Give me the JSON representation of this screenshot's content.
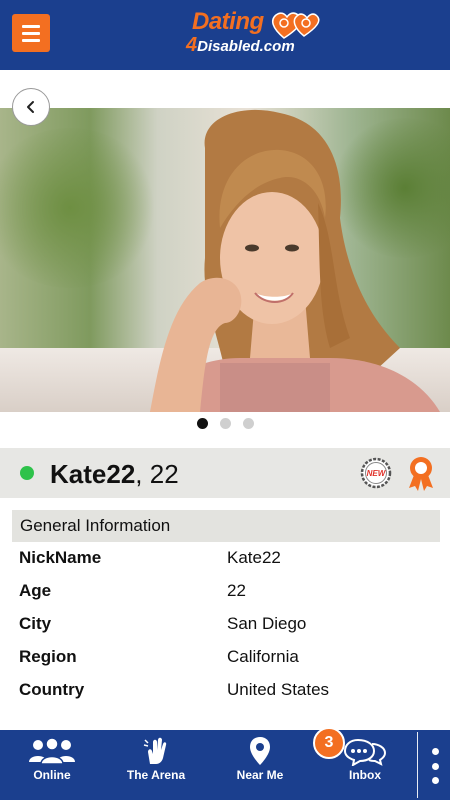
{
  "header": {
    "logo_line1": "Dating",
    "logo_number": "4",
    "logo_line2": "Disabled.com"
  },
  "carousel": {
    "total_photos": 3,
    "active_index": 0
  },
  "profile": {
    "nickname": "Kate22",
    "age_suffix": ", 22",
    "online": true,
    "new_badge": "NEW"
  },
  "general_info": {
    "title": "General Information",
    "rows": [
      {
        "label": "NickName",
        "value": "Kate22"
      },
      {
        "label": "Age",
        "value": "22"
      },
      {
        "label": "City",
        "value": "San Diego"
      },
      {
        "label": "Region",
        "value": "California"
      },
      {
        "label": "Country",
        "value": "United States"
      }
    ]
  },
  "bottom_nav": {
    "items": [
      {
        "label": "Online",
        "icon": "users-icon"
      },
      {
        "label": "The Arena",
        "icon": "hand-icon"
      },
      {
        "label": "Near Me",
        "icon": "location-pin-icon"
      },
      {
        "label": "Inbox",
        "icon": "chat-bubbles-icon"
      }
    ],
    "inbox_count": "3"
  },
  "colors": {
    "brand_blue": "#1b3f8e",
    "brand_orange": "#f36f21",
    "online_green": "#2ec24a"
  }
}
